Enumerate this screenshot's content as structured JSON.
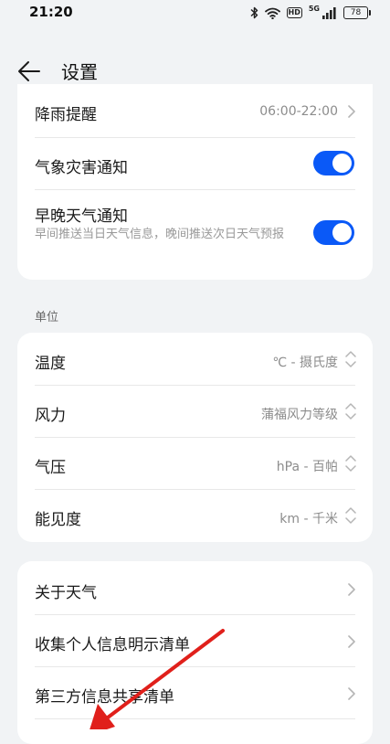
{
  "status_bar": {
    "time": "21:20",
    "signal_label": "5G",
    "hd_label": "HD",
    "battery": "78"
  },
  "header": {
    "title": "设置"
  },
  "notifications": {
    "rain_reminder": {
      "label": "降雨提醒",
      "value": "06:00-22:00"
    },
    "disaster_notice": {
      "label": "气象灾害通知",
      "enabled": true
    },
    "morning_evening_notice": {
      "label": "早晚天气通知",
      "description": "早间推送当日天气信息，晚间推送次日天气预报",
      "enabled": true
    }
  },
  "units": {
    "section_label": "单位",
    "items": [
      {
        "label": "温度",
        "value": "℃ - 摄氏度"
      },
      {
        "label": "风力",
        "value": "蒲福风力等级"
      },
      {
        "label": "气压",
        "value": "hPa - 百帕"
      },
      {
        "label": "能见度",
        "value": "km - 千米"
      }
    ]
  },
  "about": {
    "items": [
      {
        "label": "关于天气"
      },
      {
        "label": "收集个人信息明示清单"
      },
      {
        "label": "第三方信息共享清单"
      }
    ]
  },
  "colors": {
    "accent": "#0a59f7",
    "background": "#f1f3f5",
    "card": "#ffffff",
    "annotation_arrow": "#e0201b"
  },
  "icons": {
    "back": "arrow-left-icon",
    "chevron": "chevron-right-icon",
    "updown": "chevron-up-down-icon",
    "bluetooth": "bluetooth-icon",
    "wifi": "wifi-icon",
    "signal": "signal-icon"
  }
}
